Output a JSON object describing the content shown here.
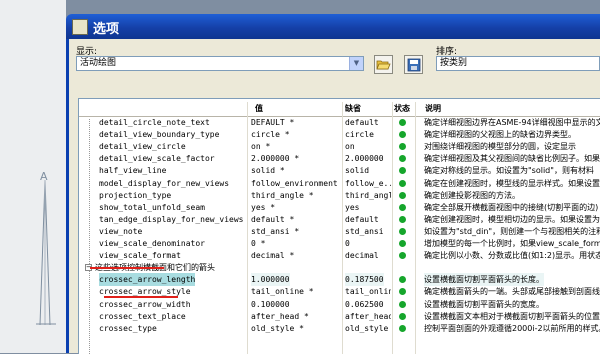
{
  "window": {
    "title": "选项"
  },
  "show": {
    "label": "显示:",
    "value": "活动绘图"
  },
  "sort": {
    "label": "排序:",
    "value": "按类别"
  },
  "toolbar": {
    "open_icon": "folder-open-icon",
    "save_icon": "save-icon"
  },
  "table": {
    "headers": {
      "value": "值",
      "default": "缺省",
      "status": "状态",
      "desc": "说明"
    },
    "rows": [
      {
        "name": "detail_circle_note_text",
        "value": "DEFAULT *",
        "default": "default",
        "desc": "确定详细视图边界在ASME-94详细视图中显示的文本"
      },
      {
        "name": "detail_view_boundary_type",
        "value": "circle *",
        "default": "circle",
        "desc": "确定详细视图的父视图上的缺省边界类型。"
      },
      {
        "name": "detail_view_circle",
        "value": "on *",
        "default": "on",
        "desc": "对围绕详细视图的模型部分的圆，设定显示"
      },
      {
        "name": "detail_view_scale_factor",
        "value": "2.000000 *",
        "default": "2.000000",
        "desc": "确定详细视图及其父视图间的缺省比例因子。如果"
      },
      {
        "name": "half_view_line",
        "value": "solid *",
        "default": "solid",
        "desc": "确定对称线的显示。如设置为\"solid\"，则有材料"
      },
      {
        "name": "model_display_for_new_views",
        "value": "follow_environment *",
        "default": "follow_e...",
        "desc": "确定在创建视图时，模型线的显示样式。如果设置"
      },
      {
        "name": "projection_type",
        "value": "third_angle *",
        "default": "third_angle",
        "desc": "确定创建投影视图的方法。"
      },
      {
        "name": "show_total_unfold_seam",
        "value": "yes *",
        "default": "yes",
        "desc": "确定全部展开横截面视图中的接缝(切割平面的边)"
      },
      {
        "name": "tan_edge_display_for_new_views",
        "value": "default *",
        "default": "default",
        "desc": "确定创建视图时，模型相切边的显示。如果设置为"
      },
      {
        "name": "view_note",
        "value": "std_ansi *",
        "default": "std_ansi",
        "desc": "如设置为\"std_din\"，则创建一个与视图相关的注释"
      },
      {
        "name": "view_scale_denominator",
        "value": "0 *",
        "default": "0",
        "desc": "增加模型的每一个比例时，如果view_scale_format"
      },
      {
        "name": "view_scale_format",
        "value": "decimal *",
        "default": "decimal",
        "desc": "确定比例以小数、分数或比值(如1:2)显示。用状态"
      }
    ],
    "group": {
      "label": "这些选项控制横截面和它们的箭头"
    },
    "group_rows": [
      {
        "name": "crossec_arrow_length",
        "value": "1.000000",
        "default": "0.187500",
        "desc": "设置横截面切割平面箭头的长度。"
      },
      {
        "name": "crossec_arrow_style",
        "value": "tail_online *",
        "default": "tail_online",
        "desc": "确定横截面箭头的一端。头部或尾部接触到剖面线。"
      },
      {
        "name": "crossec_arrow_width",
        "value": "0.100000",
        "default": "0.062500",
        "desc": "设置横截面切割平面箭头的宽度。"
      },
      {
        "name": "crossec_text_place",
        "value": "after_head *",
        "default": "after_head",
        "desc": "设置横截面文本相对于横截面切割平面箭头的位置。"
      },
      {
        "name": "crossec_type",
        "value": "old_style *",
        "default": "old_style",
        "desc": "控制平面剖面的外观遵循2000i-2以前所用的样式。"
      }
    ]
  },
  "colors": {
    "status_dot": "#16a62c",
    "title_bar": "#1540a8",
    "highlight": "#a8dce0",
    "underline": "#e0201a"
  }
}
